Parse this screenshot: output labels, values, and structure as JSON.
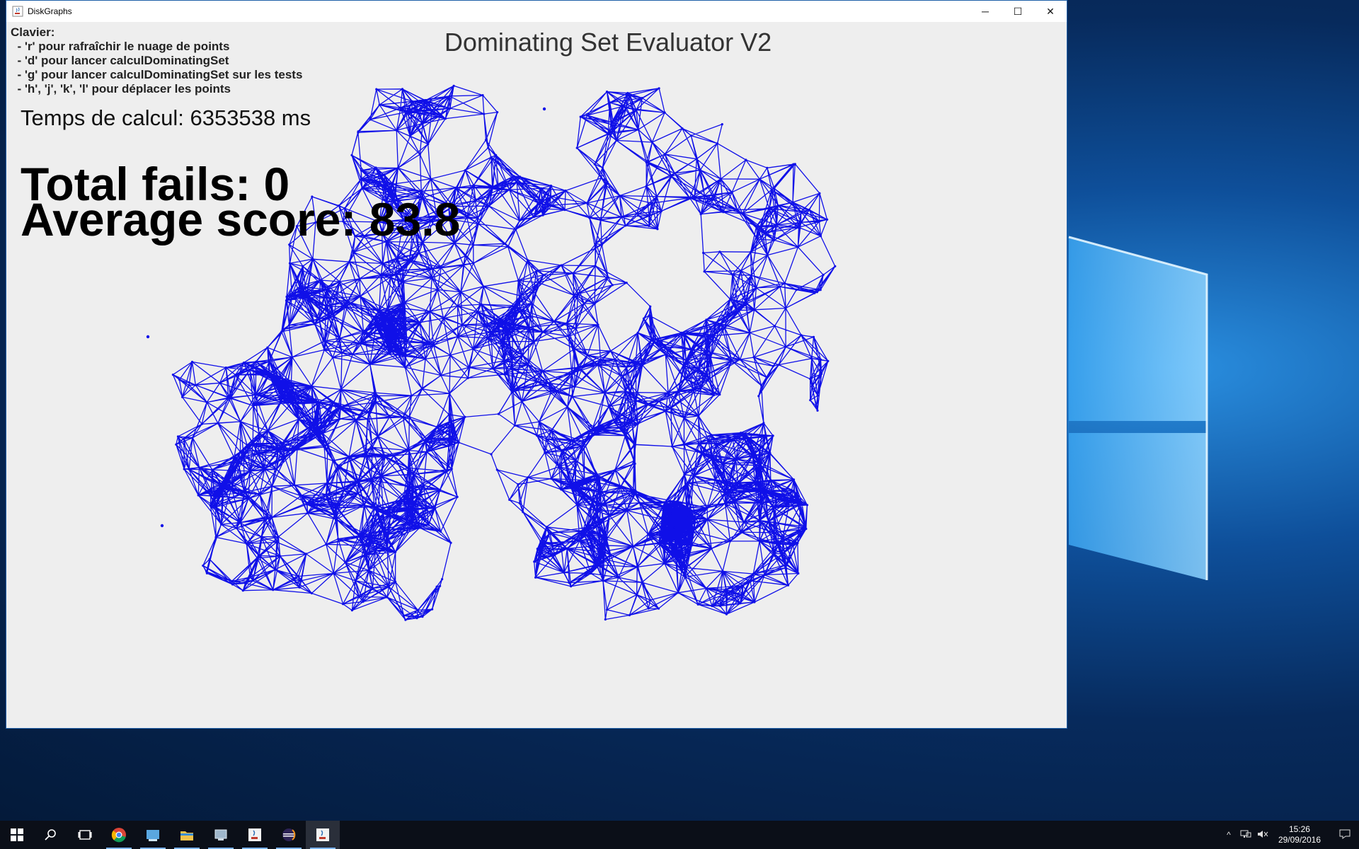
{
  "window": {
    "title": "DiskGraphs",
    "minimize_glyph": "─",
    "maximize_glyph": "☐",
    "close_glyph": "✕"
  },
  "app": {
    "heading": "Dominating Set Evaluator V2",
    "help_lines": [
      "Clavier:",
      "  - 'r' pour rafraîchir le nuage de points",
      "  - 'd' pour lancer calculDominatingSet",
      "  - 'g' pour lancer calculDominatingSet sur les tests",
      "  - 'h', 'j', 'k', 'l' pour déplacer les points"
    ],
    "calc_time": "Temps de calcul: 6353538 ms",
    "total_fails": "Total fails: 0",
    "average_score": "Average score: 83.8",
    "graph_color": "#1010e8"
  },
  "taskbar": {
    "items": [
      {
        "name": "start-icon"
      },
      {
        "name": "search-icon"
      },
      {
        "name": "task-view-icon"
      },
      {
        "name": "chrome-icon"
      },
      {
        "name": "terminal-icon"
      },
      {
        "name": "file-explorer-icon"
      },
      {
        "name": "control-panel-icon"
      },
      {
        "name": "java-icon"
      },
      {
        "name": "eclipse-icon"
      },
      {
        "name": "java-app-icon"
      }
    ],
    "clock_time": "15:26",
    "clock_date": "29/09/2016"
  },
  "colors": {
    "taskbar": "#0b0f18",
    "accent": "#7eb6ff"
  }
}
